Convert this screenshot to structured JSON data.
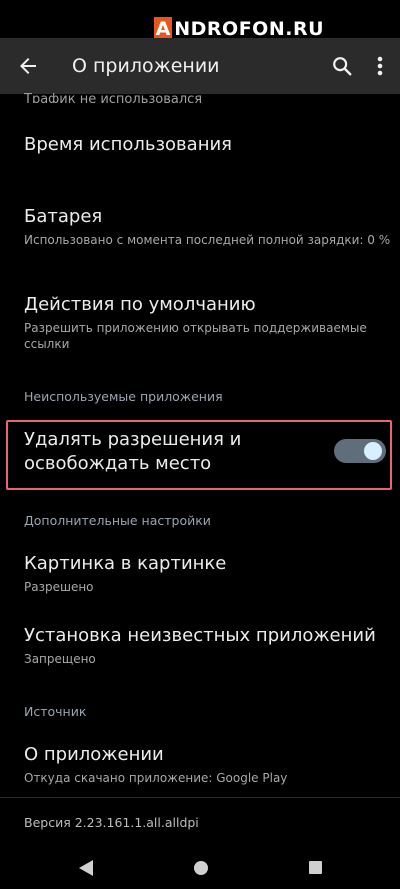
{
  "watermark": {
    "brand": "NDROFON.RU",
    "badge": "A"
  },
  "appbar": {
    "title": "О приложении"
  },
  "items": {
    "cut_text": "Трафик не использовался",
    "usage_time": {
      "title": "Время использования"
    },
    "battery": {
      "title": "Батарея",
      "subtitle": "Использовано с момента последней полной зарядки: 0 %"
    },
    "defaults": {
      "title": "Действия по умолчанию",
      "subtitle": "Разрешить приложению открывать поддерживаемые ссылки"
    },
    "unused_header": "Неиспользуемые приложения",
    "remove_permissions": {
      "title": "Удалять разрешения и освобождать место",
      "enabled": true
    },
    "advanced_header": "Дополнительные настройки",
    "pip": {
      "title": "Картинка в картинке",
      "subtitle": "Разрешено"
    },
    "unknown_apps": {
      "title": "Установка неизвестных приложений",
      "subtitle": "Запрещено"
    },
    "source_header": "Источник",
    "about": {
      "title": "О приложении",
      "subtitle": "Откуда скачано приложение: Google Play"
    },
    "version": "Версия 2.23.161.1.all.alldpi"
  },
  "colors": {
    "appbar_bg": "#2b2b2b",
    "highlight_border": "#e8666f",
    "toggle_track": "#5f6e7a",
    "toggle_thumb": "#d8efff",
    "watermark_badge": "#e8561f"
  },
  "icons": {
    "back": "arrow-left",
    "search": "magnifier",
    "more": "vertical-ellipsis",
    "nav_back": "triangle-left",
    "nav_home": "circle",
    "nav_recent": "square"
  }
}
